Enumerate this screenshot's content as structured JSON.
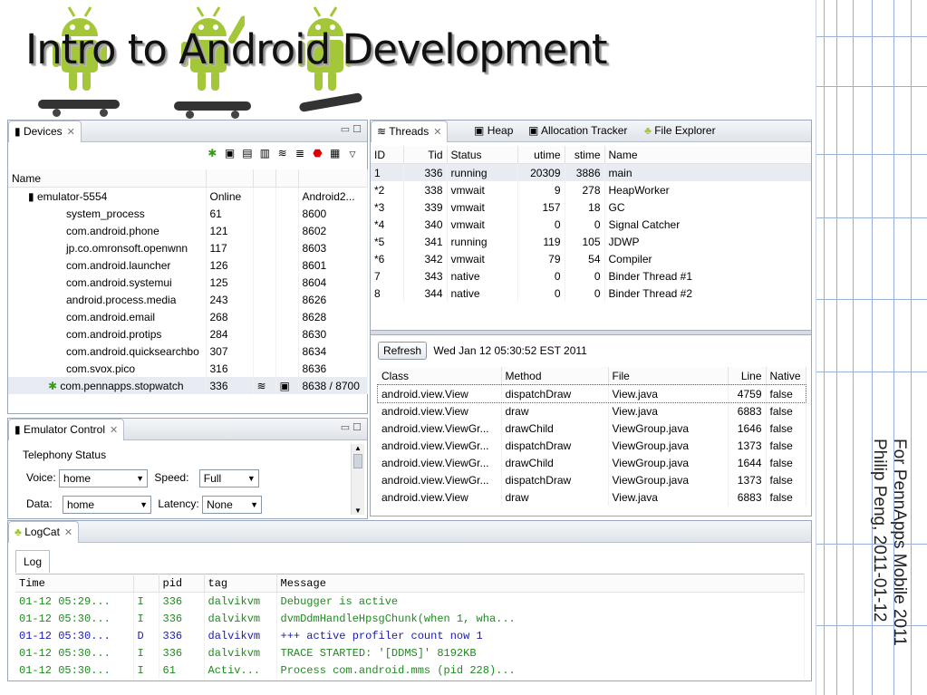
{
  "slide": {
    "title": "Intro to Android Development",
    "credit_line1": "For PennApps Mobile 2011",
    "credit_line2": "Philip Peng, 2011-01-12"
  },
  "devices": {
    "tab_label": "Devices",
    "header": "Name",
    "emulator": {
      "name": "emulator-5554",
      "state": "Online",
      "target": "Android2..."
    },
    "processes": [
      {
        "name": "system_process",
        "pid": "61",
        "port": "8600"
      },
      {
        "name": "com.android.phone",
        "pid": "121",
        "port": "8602"
      },
      {
        "name": "jp.co.omronsoft.openwnn",
        "pid": "117",
        "port": "8603"
      },
      {
        "name": "com.android.launcher",
        "pid": "126",
        "port": "8601"
      },
      {
        "name": "com.android.systemui",
        "pid": "125",
        "port": "8604"
      },
      {
        "name": "android.process.media",
        "pid": "243",
        "port": "8626"
      },
      {
        "name": "com.android.email",
        "pid": "268",
        "port": "8628"
      },
      {
        "name": "com.android.protips",
        "pid": "284",
        "port": "8630"
      },
      {
        "name": "com.android.quicksearchbo",
        "pid": "307",
        "port": "8634"
      },
      {
        "name": "com.svox.pico",
        "pid": "316",
        "port": "8636"
      }
    ],
    "selected": {
      "name": "com.pennapps.stopwatch",
      "pid": "336",
      "port": "8638 / 8700"
    }
  },
  "threads_panel": {
    "tabs": [
      "Threads",
      "Heap",
      "Allocation Tracker",
      "File Explorer"
    ],
    "columns": [
      "ID",
      "Tid",
      "Status",
      "utime",
      "stime",
      "Name"
    ],
    "rows": [
      [
        "1",
        "336",
        "running",
        "20309",
        "3886",
        "main"
      ],
      [
        "*2",
        "338",
        "vmwait",
        "9",
        "278",
        "HeapWorker"
      ],
      [
        "*3",
        "339",
        "vmwait",
        "157",
        "18",
        "GC"
      ],
      [
        "*4",
        "340",
        "vmwait",
        "0",
        "0",
        "Signal Catcher"
      ],
      [
        "*5",
        "341",
        "running",
        "119",
        "105",
        "JDWP"
      ],
      [
        "*6",
        "342",
        "vmwait",
        "79",
        "54",
        "Compiler"
      ],
      [
        "7",
        "343",
        "native",
        "0",
        "0",
        "Binder Thread #1"
      ],
      [
        "8",
        "344",
        "native",
        "0",
        "0",
        "Binder Thread #2"
      ]
    ],
    "refresh_label": "Refresh",
    "timestamp": "Wed Jan 12 05:30:52 EST 2011",
    "stack_columns": [
      "Class",
      "Method",
      "File",
      "Line",
      "Native"
    ],
    "stack_rows": [
      [
        "android.view.View",
        "dispatchDraw",
        "View.java",
        "4759",
        "false"
      ],
      [
        "android.view.View",
        "draw",
        "View.java",
        "6883",
        "false"
      ],
      [
        "android.view.ViewGr...",
        "drawChild",
        "ViewGroup.java",
        "1646",
        "false"
      ],
      [
        "android.view.ViewGr...",
        "dispatchDraw",
        "ViewGroup.java",
        "1373",
        "false"
      ],
      [
        "android.view.ViewGr...",
        "drawChild",
        "ViewGroup.java",
        "1644",
        "false"
      ],
      [
        "android.view.ViewGr...",
        "dispatchDraw",
        "ViewGroup.java",
        "1373",
        "false"
      ],
      [
        "android.view.View",
        "draw",
        "View.java",
        "6883",
        "false"
      ]
    ]
  },
  "emulator_control": {
    "tab_label": "Emulator Control",
    "group_label": "Telephony Status",
    "voice_label": "Voice:",
    "voice_value": "home",
    "speed_label": "Speed:",
    "speed_value": "Full",
    "data_label": "Data:",
    "data_value": "home",
    "latency_label": "Latency:",
    "latency_value": "None"
  },
  "logcat": {
    "tab_label": "LogCat",
    "subtab_label": "Log",
    "columns": [
      "Time",
      "",
      "pid",
      "tag",
      "Message"
    ],
    "rows": [
      [
        "01-12 05:29...",
        "I",
        "336",
        "dalvikvm",
        "Debugger is active"
      ],
      [
        "01-12 05:30...",
        "I",
        "336",
        "dalvikvm",
        "dvmDdmHandleHpsgChunk(when 1, wha..."
      ],
      [
        "01-12 05:30...",
        "D",
        "336",
        "dalvikvm",
        "+++ active profiler count now 1"
      ],
      [
        "01-12 05:30...",
        "I",
        "336",
        "dalvikvm",
        "TRACE STARTED: '[DDMS]' 8192KB"
      ],
      [
        "01-12 05:30...",
        "I",
        "61",
        "Activ...",
        "Process com.android.mms (pid 228)..."
      ]
    ],
    "colors": {
      "I": "#1f8a1f",
      "D": "#1a1ab8"
    }
  },
  "colors": {
    "android_green": "#a4c639",
    "panel_border": "#9aa7b8"
  }
}
